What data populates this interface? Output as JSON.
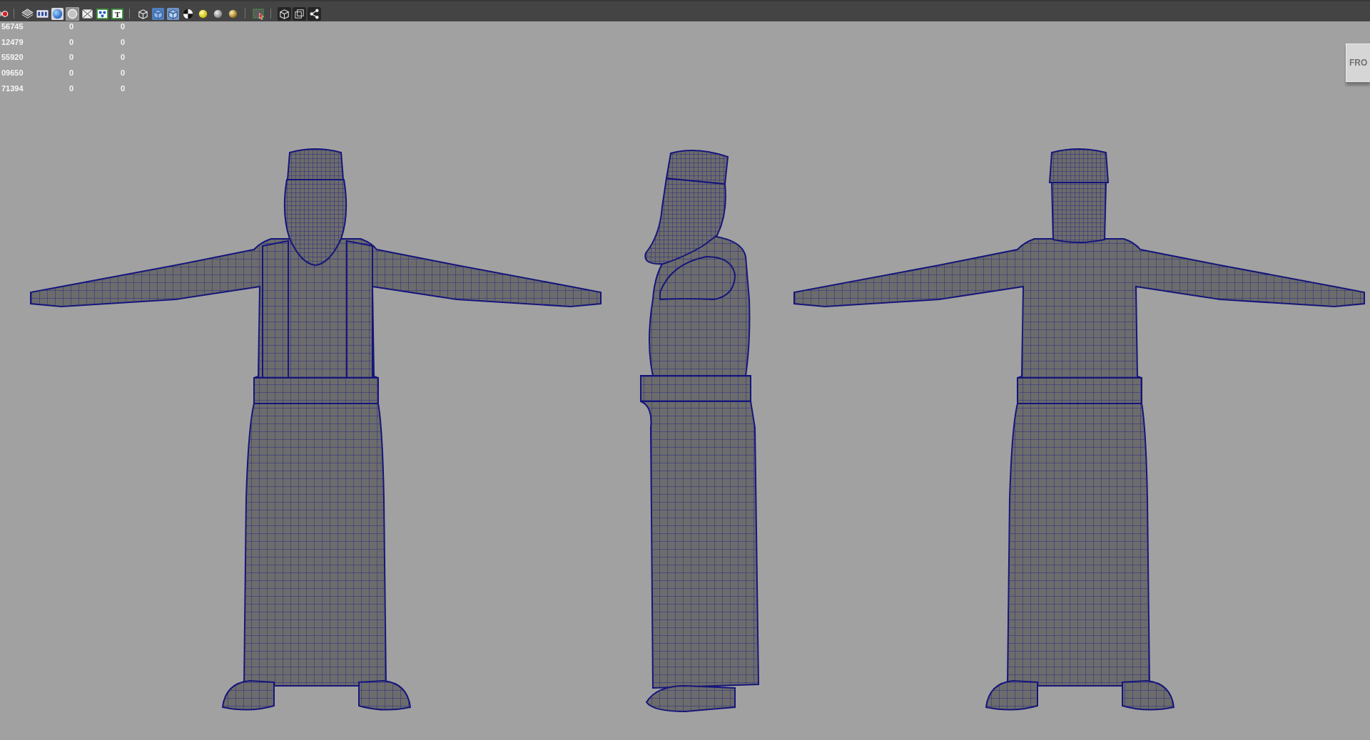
{
  "toolbar": {
    "groups": [
      [
        {
          "kind": "dot",
          "on": false
        }
      ],
      [
        {
          "kind": "layers",
          "on": false
        },
        {
          "kind": "film",
          "on": false
        },
        {
          "kind": "sphere",
          "on": false
        },
        {
          "kind": "circle",
          "on": true
        },
        {
          "kind": "crossed-box",
          "on": false
        },
        {
          "kind": "nodes",
          "on": false
        },
        {
          "kind": "text",
          "on": false,
          "label": "T"
        }
      ],
      [
        {
          "kind": "wire-cube",
          "on": false
        },
        {
          "kind": "shaded-cube",
          "on": false
        },
        {
          "kind": "wire-shaded-cube",
          "on": false
        },
        {
          "kind": "checker",
          "on": false
        },
        {
          "kind": "bright-sphere",
          "on": false
        },
        {
          "kind": "matte-sphere",
          "on": false
        },
        {
          "kind": "glossy-sphere",
          "on": false
        }
      ],
      [
        {
          "kind": "selection",
          "on": false
        }
      ],
      [
        {
          "kind": "cube",
          "on": false
        },
        {
          "kind": "overlap",
          "on": false
        },
        {
          "kind": "share",
          "on": false
        }
      ]
    ]
  },
  "hud": {
    "rows": [
      {
        "cells": [
          "56745",
          "0",
          "0"
        ]
      },
      {
        "cells": [
          "12479",
          "0",
          "0"
        ]
      },
      {
        "cells": [
          "55920",
          "0",
          "0"
        ]
      },
      {
        "cells": [
          "09650",
          "0",
          "0"
        ]
      },
      {
        "cells": [
          "71394",
          "0",
          "0"
        ]
      }
    ]
  },
  "view_cube": {
    "label": "FRO"
  }
}
